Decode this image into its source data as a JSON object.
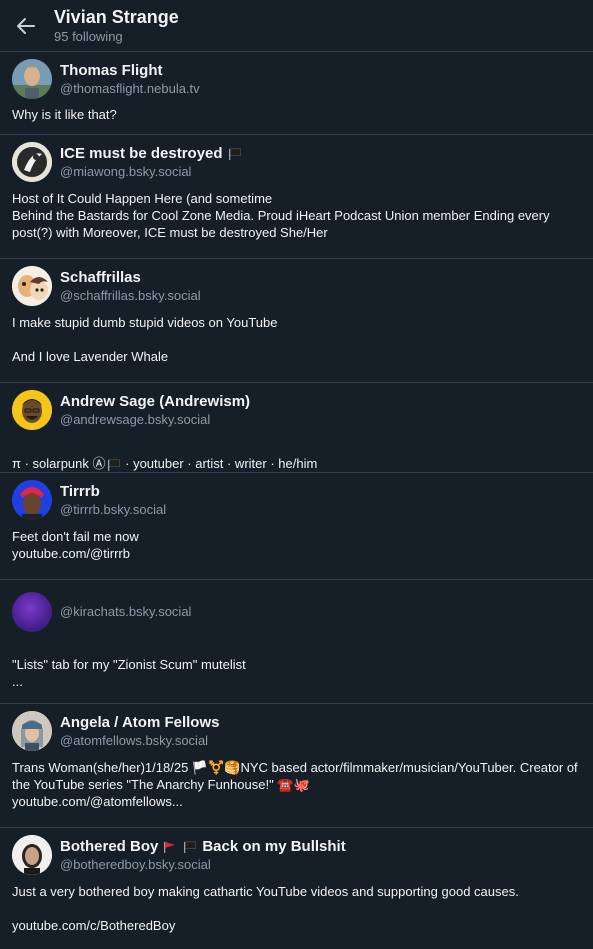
{
  "header": {
    "title": "Vivian Strange",
    "subtitle": "95 following"
  },
  "users": [
    {
      "display_name": "Thomas Flight",
      "handle": "@thomasflight.nebula.tv",
      "bio": "Why is it like that?"
    },
    {
      "display_name": "ICE must be destroyed",
      "handle": "@miawong.bsky.social",
      "bio": "Host of It Could Happen Here (and sometime\nBehind the Bastards for Cool Zone Media. Proud iHeart Podcast Union member Ending every post(?) with Moreover, ICE must be destroyed She/Her"
    },
    {
      "display_name": "Schaffrillas",
      "handle": "@schaffrillas.bsky.social",
      "bio": "I make stupid dumb stupid videos on YouTube\n\nAnd I love Lavender Whale"
    },
    {
      "display_name": "Andrew Sage (Andrewism)",
      "handle": "@andrewsage.bsky.social",
      "bio_before": "π · solarpunk Ⓐ",
      "bio_after": " · youtuber · artist · writer · he/him"
    },
    {
      "display_name": "Tirrrb",
      "handle": "@tirrrb.bsky.social",
      "bio": "Feet don't fail me now\nyoutube.com/@tirrrb"
    },
    {
      "display_name": "",
      "handle": "@kirachats.bsky.social",
      "bio": "\"Lists\" tab for my \"Zionist Scum\" mutelist\n..."
    },
    {
      "display_name": "Angela / Atom Fellows",
      "handle": "@atomfellows.bsky.social",
      "bio": "Trans Woman(she/her)1/18/25 🏳️⚧️🥞NYC based actor/filmmaker/musician/YouTuber. Creator of the YouTube series \"The Anarchy Funhouse!\" ☎️🐙\nyoutube.com/@atomfellows..."
    },
    {
      "display_name_before": "Bothered Boy",
      "display_name_after": "Back on my Bullshit",
      "handle": "@botheredboy.bsky.social",
      "bio": "Just a very bothered boy making cathartic YouTube videos and supporting good causes.\n\nyoutube.com/c/BotheredBoy"
    }
  ],
  "colors": {
    "background": "#161e27",
    "divider": "#2e4052",
    "text": "#f1f3f5",
    "muted": "#8d9aab"
  },
  "icons": {
    "back": "arrow-left-icon",
    "flag_black": "black-flag-icon",
    "flag_red": "red-flag-icon"
  }
}
